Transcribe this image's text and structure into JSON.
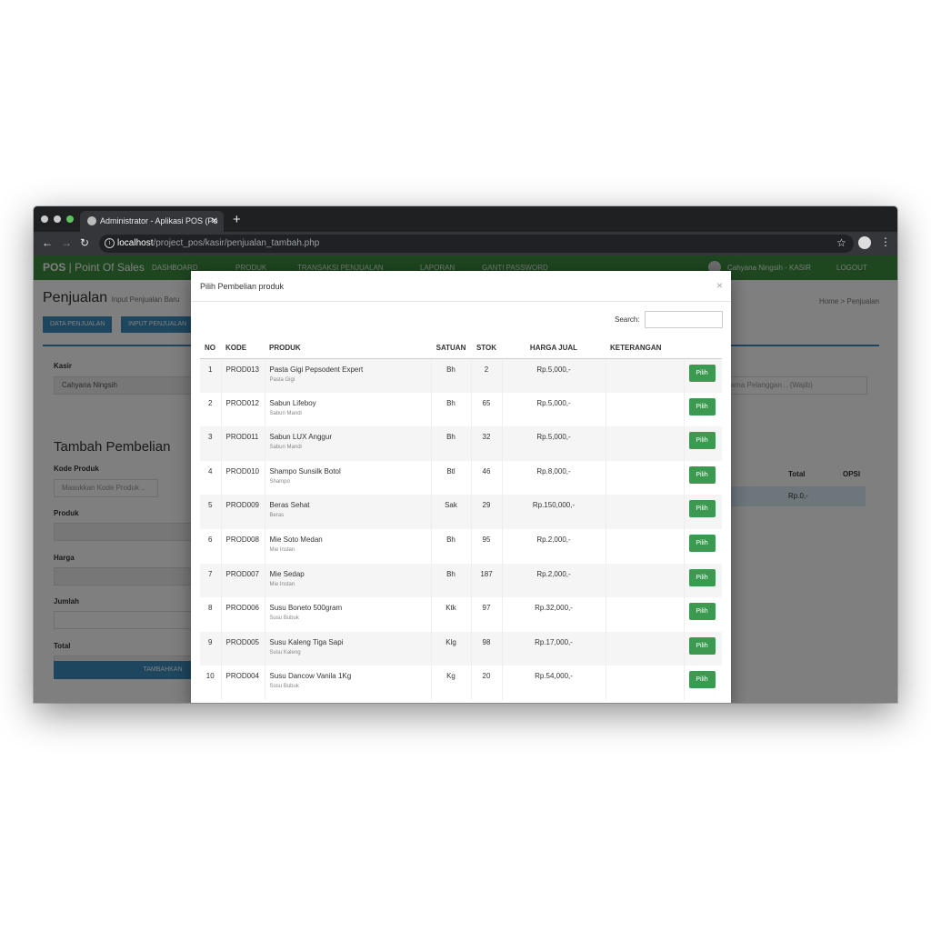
{
  "browser": {
    "tab_title": "Administrator - Aplikasi POS (Po",
    "url_host": "localhost",
    "url_path": "/project_pos/kasir/penjualan_tambah.php"
  },
  "navbar": {
    "brand_bold": "POS",
    "brand_rest": " | Point Of Sales",
    "items": [
      "DASHBOARD",
      "PRODUK",
      "TRANSAKSI PENJUALAN",
      "LAPORAN",
      "GANTI PASSWORD"
    ],
    "user": "Cahyana Ningsih - KASIR",
    "logout": "LOGOUT"
  },
  "content": {
    "title": "Penjualan",
    "subtitle": "Input Penjualan Baru",
    "breadcrumb_home": "Home",
    "breadcrumb_current": "Penjualan",
    "btn_data": "DATA PENJUALAN",
    "btn_input": "INPUT PENJUALAN",
    "kasir_label": "Kasir",
    "kasir_value": "Cahyana Ningsih",
    "pelanggan_placeholder": "Nama Pelanggan .. (Wajib)",
    "section_title": "Tambah Pembelian",
    "kode_label": "Kode Produk",
    "kode_placeholder": "Masukkan Kode Produk ..",
    "produk_label": "Produk",
    "harga_label": "Harga",
    "jumlah_label": "Jumlah",
    "total_label": "Total",
    "tambahkan": "TAMBAHKAN",
    "col_total": "Total",
    "col_opsi": "OPSI",
    "total_value": "Rp.0,-"
  },
  "modal": {
    "title": "Pilih Pembelian produk",
    "close": "×",
    "search_label": "Search:",
    "columns": [
      "NO",
      "KODE",
      "PRODUK",
      "SATUAN",
      "STOK",
      "HARGA JUAL",
      "KETERANGAN",
      ""
    ],
    "button_label": "Pilih",
    "rows": [
      {
        "no": "1",
        "kode": "PROD013",
        "produk": "Pasta Gigi Pepsodent Expert",
        "kategori": "Pasta Gigi",
        "satuan": "Bh",
        "stok": "2",
        "harga": "Rp.5,000,-"
      },
      {
        "no": "2",
        "kode": "PROD012",
        "produk": "Sabun Lifeboy",
        "kategori": "Sabun Mandi",
        "satuan": "Bh",
        "stok": "65",
        "harga": "Rp.5,000,-"
      },
      {
        "no": "3",
        "kode": "PROD011",
        "produk": "Sabun LUX Anggur",
        "kategori": "Sabun Mandi",
        "satuan": "Bh",
        "stok": "32",
        "harga": "Rp.5,000,-"
      },
      {
        "no": "4",
        "kode": "PROD010",
        "produk": "Shampo Sunsilk Botol",
        "kategori": "Shampo",
        "satuan": "Btl",
        "stok": "46",
        "harga": "Rp.8,000,-"
      },
      {
        "no": "5",
        "kode": "PROD009",
        "produk": "Beras Sehat",
        "kategori": "Beras",
        "satuan": "Sak",
        "stok": "29",
        "harga": "Rp.150,000,-"
      },
      {
        "no": "6",
        "kode": "PROD008",
        "produk": "Mie Soto Medan",
        "kategori": "Mie Instan",
        "satuan": "Bh",
        "stok": "95",
        "harga": "Rp.2,000,-"
      },
      {
        "no": "7",
        "kode": "PROD007",
        "produk": "Mie Sedap",
        "kategori": "Mie Instan",
        "satuan": "Bh",
        "stok": "187",
        "harga": "Rp.2,000,-"
      },
      {
        "no": "8",
        "kode": "PROD006",
        "produk": "Susu Boneto 500gram",
        "kategori": "Susu Bubuk",
        "satuan": "Ktk",
        "stok": "97",
        "harga": "Rp.32,000,-"
      },
      {
        "no": "9",
        "kode": "PROD005",
        "produk": "Susu Kaleng Tiga Sapi",
        "kategori": "Susu Kaleng",
        "satuan": "Klg",
        "stok": "98",
        "harga": "Rp.17,000,-"
      },
      {
        "no": "10",
        "kode": "PROD004",
        "produk": "Susu Dancow Vanila 1Kg",
        "kategori": "Susu Bubuk",
        "satuan": "Kg",
        "stok": "20",
        "harga": "Rp.54,000,-"
      }
    ]
  }
}
